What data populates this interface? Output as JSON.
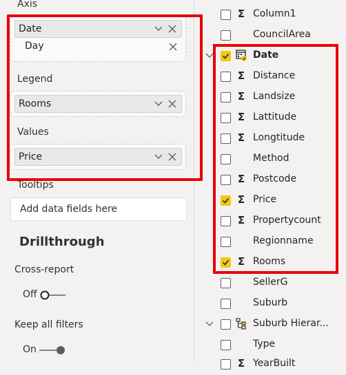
{
  "left_pane": {
    "axis": {
      "label": "Axis",
      "field": "Date",
      "subfield": "Day"
    },
    "legend": {
      "label": "Legend",
      "field": "Rooms"
    },
    "values": {
      "label": "Values",
      "field": "Price"
    },
    "tooltips": {
      "label": "Tooltips",
      "placeholder": "Add data fields here"
    },
    "drillthrough": {
      "title": "Drillthrough",
      "cross_report": {
        "label": "Cross-report",
        "state": "Off"
      },
      "keep_all_filters": {
        "label": "Keep all filters",
        "state": "On"
      }
    }
  },
  "fields": [
    {
      "name": "Column1",
      "type": "sigma",
      "checked": false,
      "expander": false,
      "bold": false
    },
    {
      "name": "CouncilArea",
      "type": "none",
      "checked": false,
      "expander": false,
      "bold": false
    },
    {
      "name": "Date",
      "type": "calendar",
      "checked": true,
      "expander": true,
      "bold": true
    },
    {
      "name": "Distance",
      "type": "sigma",
      "checked": false,
      "expander": false,
      "bold": false
    },
    {
      "name": "Landsize",
      "type": "sigma",
      "checked": false,
      "expander": false,
      "bold": false
    },
    {
      "name": "Lattitude",
      "type": "sigma",
      "checked": false,
      "expander": false,
      "bold": false
    },
    {
      "name": "Longtitude",
      "type": "sigma",
      "checked": false,
      "expander": false,
      "bold": false
    },
    {
      "name": "Method",
      "type": "none",
      "checked": false,
      "expander": false,
      "bold": false
    },
    {
      "name": "Postcode",
      "type": "sigma",
      "checked": false,
      "expander": false,
      "bold": false
    },
    {
      "name": "Price",
      "type": "sigma",
      "checked": true,
      "expander": false,
      "bold": false
    },
    {
      "name": "Propertycount",
      "type": "sigma",
      "checked": false,
      "expander": false,
      "bold": false
    },
    {
      "name": "Regionname",
      "type": "none",
      "checked": false,
      "expander": false,
      "bold": false
    },
    {
      "name": "Rooms",
      "type": "sigma",
      "checked": true,
      "expander": false,
      "bold": false
    },
    {
      "name": "SellerG",
      "type": "none",
      "checked": false,
      "expander": false,
      "bold": false
    },
    {
      "name": "Suburb",
      "type": "none",
      "checked": false,
      "expander": false,
      "bold": false
    },
    {
      "name": "Suburb Hierar...",
      "type": "hierarchy",
      "checked": false,
      "expander": true,
      "bold": false
    },
    {
      "name": "Type",
      "type": "none",
      "checked": false,
      "expander": false,
      "bold": false
    },
    {
      "name": "YearBuilt",
      "type": "sigma",
      "checked": false,
      "expander": false,
      "bold": false
    }
  ],
  "colors": {
    "highlight_border": "#e8000b",
    "checkbox_checked": "#f2c811",
    "pane_background": "#f3f2f1"
  }
}
